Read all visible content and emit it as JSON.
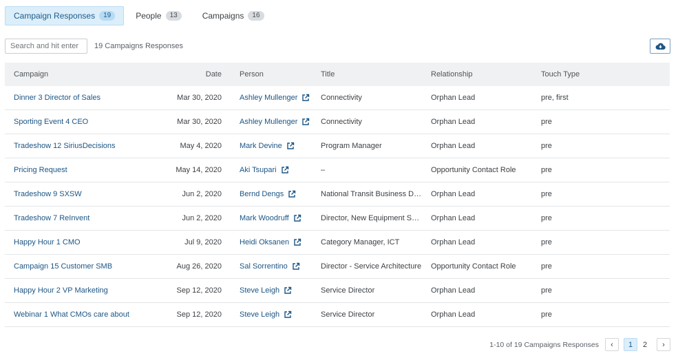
{
  "tabs": [
    {
      "label": "Campaign Responses",
      "count": "19"
    },
    {
      "label": "People",
      "count": "13"
    },
    {
      "label": "Campaigns",
      "count": "16"
    }
  ],
  "search": {
    "placeholder": "Search and hit enter",
    "value": ""
  },
  "result_count": "19 Campaigns Responses",
  "download": {
    "icon": "cloud-download-icon"
  },
  "table": {
    "headers": {
      "campaign": "Campaign",
      "date": "Date",
      "person": "Person",
      "title": "Title",
      "relationship": "Relationship",
      "touch_type": "Touch Type"
    },
    "rows": [
      {
        "campaign": "Dinner 3 Director of Sales",
        "date": "Mar 30, 2020",
        "person": "Ashley Mullenger",
        "title": "Connectivity",
        "relationship": "Orphan Lead",
        "touch_type": "pre, first"
      },
      {
        "campaign": "Sporting Event 4 CEO",
        "date": "Mar 30, 2020",
        "person": "Ashley Mullenger",
        "title": "Connectivity",
        "relationship": "Orphan Lead",
        "touch_type": "pre"
      },
      {
        "campaign": "Tradeshow 12 SiriusDecisions",
        "date": "May 4, 2020",
        "person": "Mark Devine",
        "title": "Program Manager",
        "relationship": "Orphan Lead",
        "touch_type": "pre"
      },
      {
        "campaign": "Pricing Request",
        "date": "May 14, 2020",
        "person": "Aki Tsupari",
        "title": "–",
        "relationship": "Opportunity Contact Role",
        "touch_type": "pre"
      },
      {
        "campaign": "Tradeshow 9 SXSW",
        "date": "Jun 2, 2020",
        "person": "Bernd Dengs",
        "title": "National Transit Business Development",
        "relationship": "Orphan Lead",
        "touch_type": "pre"
      },
      {
        "campaign": "Tradeshow 7 ReInvent",
        "date": "Jun 2, 2020",
        "person": "Mark Woodruff",
        "title": "Director, New Equipment Sales",
        "relationship": "Orphan Lead",
        "touch_type": "pre"
      },
      {
        "campaign": "Happy Hour 1 CMO",
        "date": "Jul 9, 2020",
        "person": "Heidi Oksanen",
        "title": "Category Manager, ICT",
        "relationship": "Orphan Lead",
        "touch_type": "pre"
      },
      {
        "campaign": "Campaign 15 Customer SMB",
        "date": "Aug 26, 2020",
        "person": "Sal Sorrentino",
        "title": "Director - Service Architecture",
        "relationship": "Opportunity Contact Role",
        "touch_type": "pre"
      },
      {
        "campaign": "Happy Hour 2 VP Marketing",
        "date": "Sep 12, 2020",
        "person": "Steve Leigh",
        "title": "Service Director",
        "relationship": "Orphan Lead",
        "touch_type": "pre"
      },
      {
        "campaign": "Webinar 1 What CMOs care about",
        "date": "Sep 12, 2020",
        "person": "Steve Leigh",
        "title": "Service Director",
        "relationship": "Orphan Lead",
        "touch_type": "pre"
      }
    ]
  },
  "pagination": {
    "summary": "1-10 of 19 Campaigns Responses",
    "pages": [
      "1",
      "2"
    ],
    "current": "1"
  },
  "colors": {
    "link": "#1b5585",
    "active_tab_bg": "#dbeefa",
    "header_bg": "#f0f1f2"
  }
}
